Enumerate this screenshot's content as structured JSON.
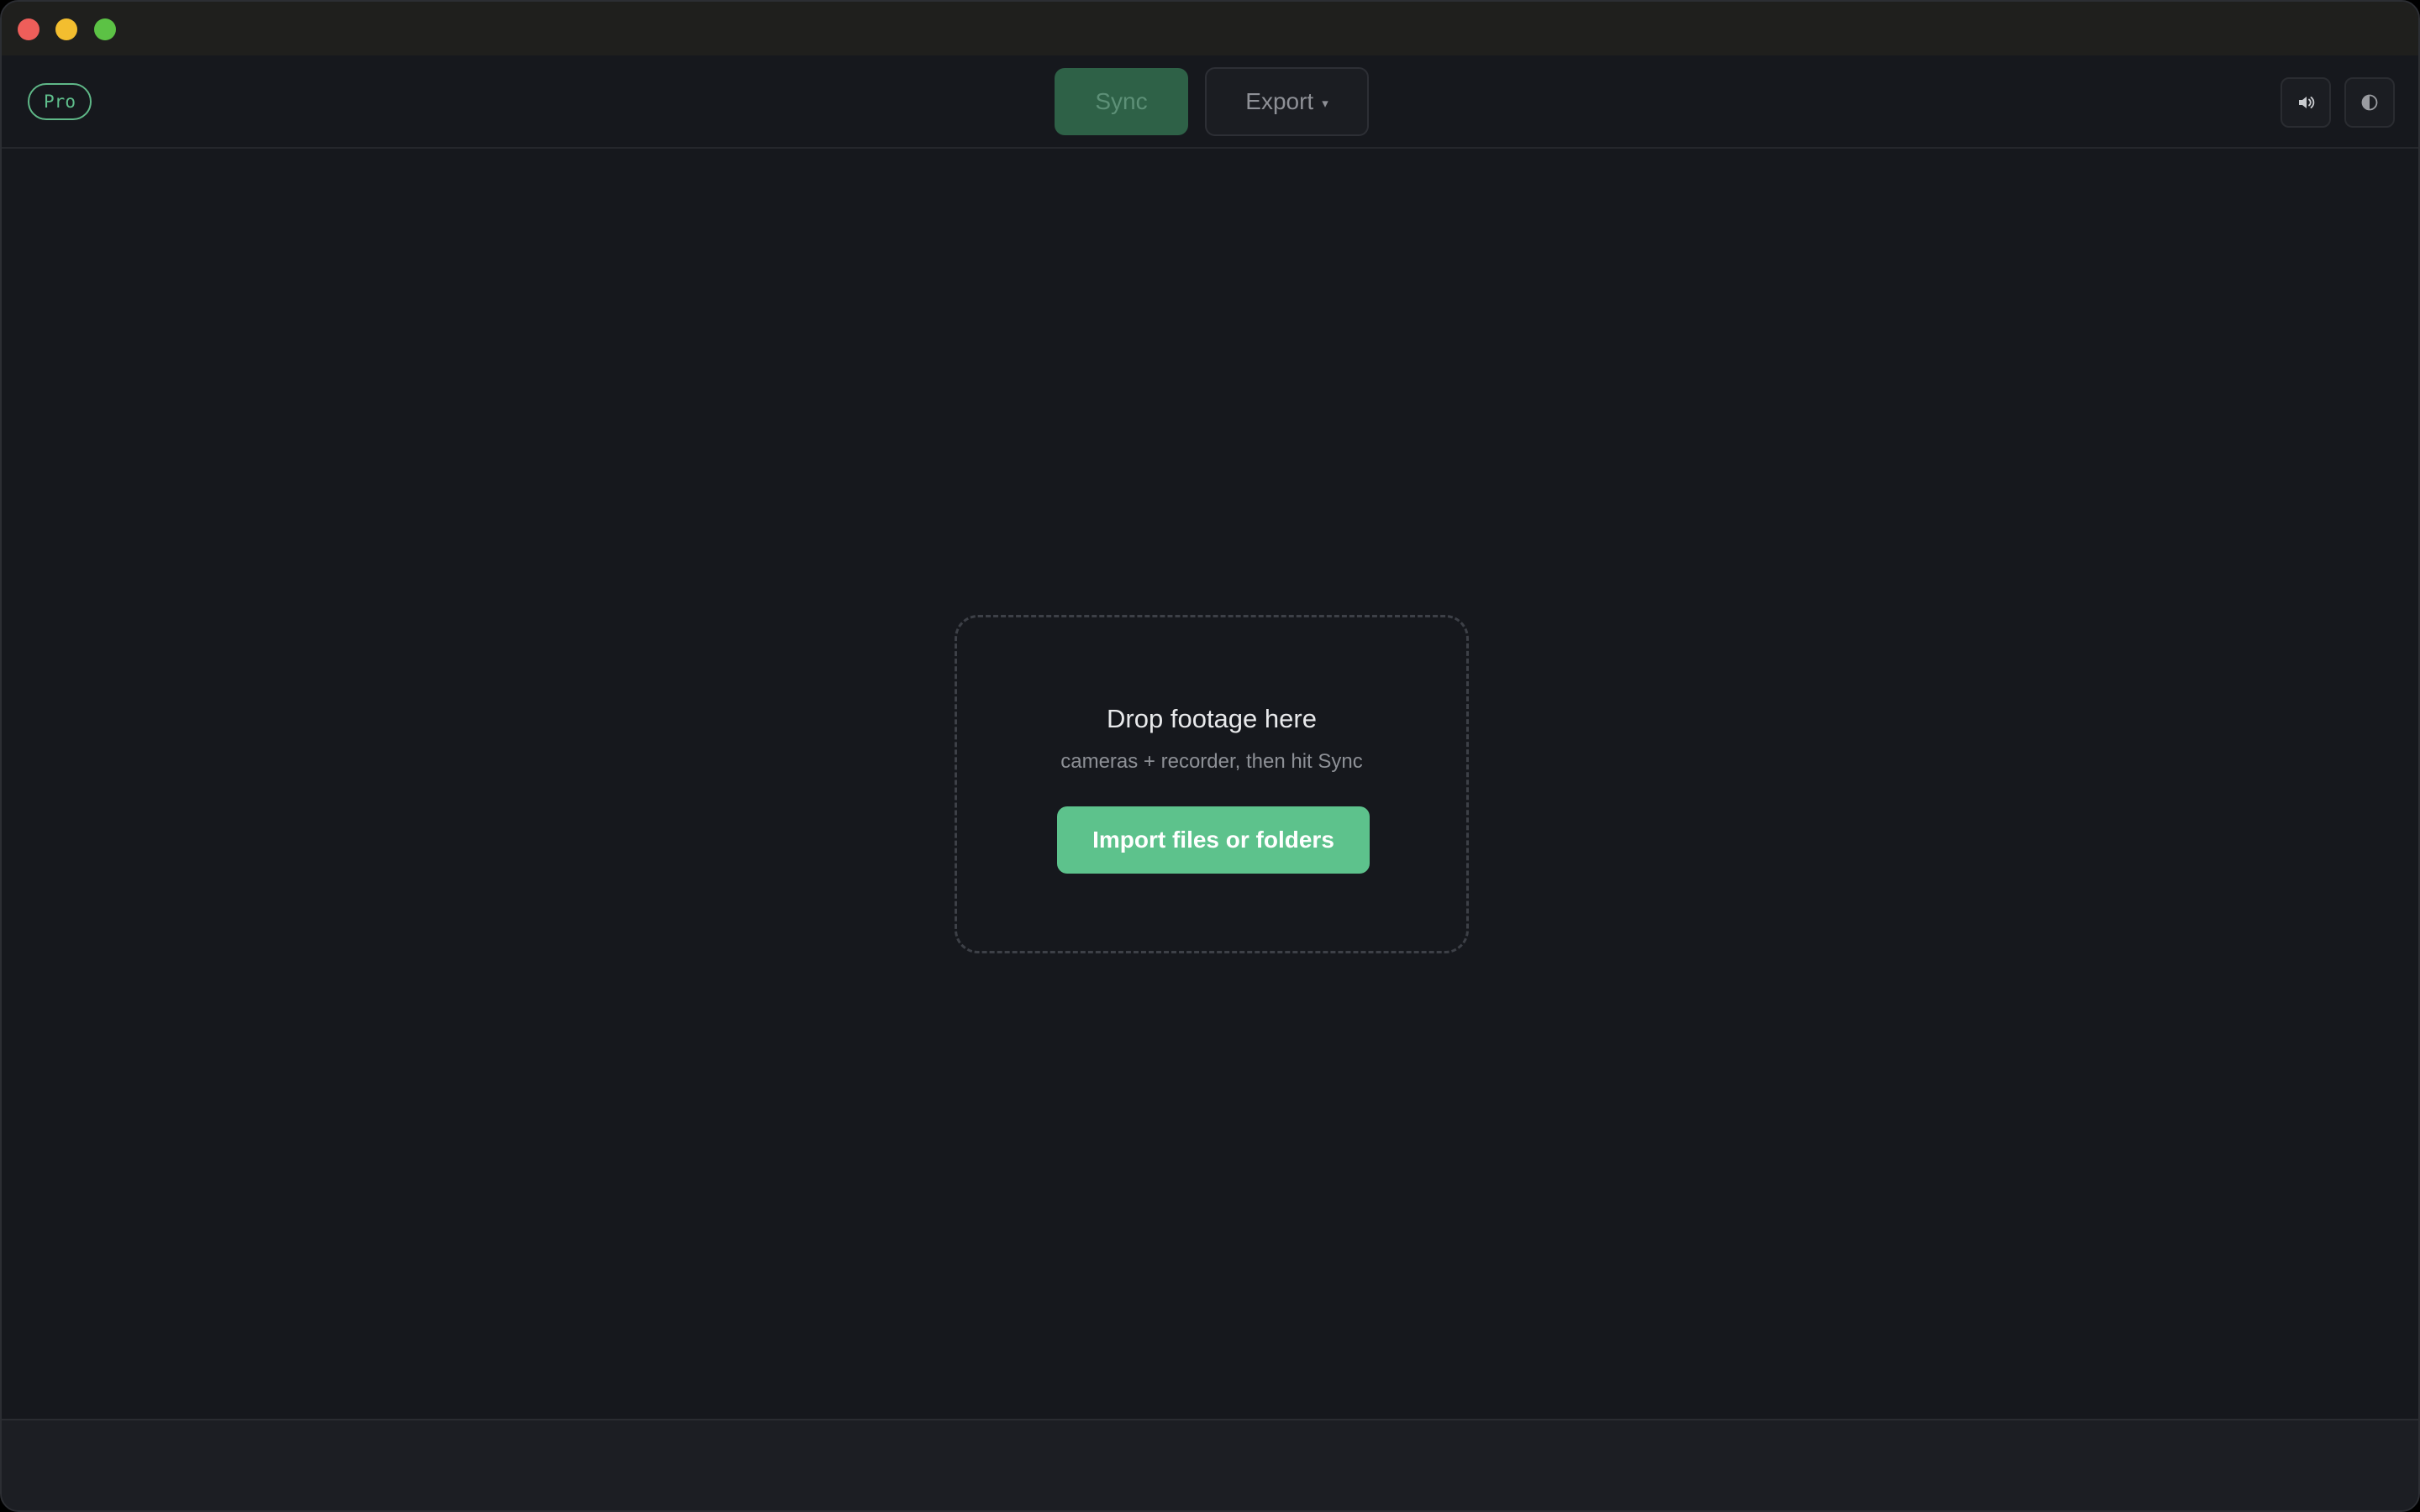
{
  "toolbar": {
    "plan_badge": "Pro",
    "sync_label": "Sync",
    "export_label": "Export",
    "export_caret": "▾"
  },
  "icons": {
    "sound": "speaker-icon",
    "theme": "contrast-icon"
  },
  "dropzone": {
    "title": "Drop footage here",
    "subtitle": "cameras + recorder, then hit Sync",
    "import_label": "Import files or folders"
  },
  "colors": {
    "accent": "#5dc28c",
    "accent_dim": "#2e6147",
    "background": "#16181d"
  }
}
